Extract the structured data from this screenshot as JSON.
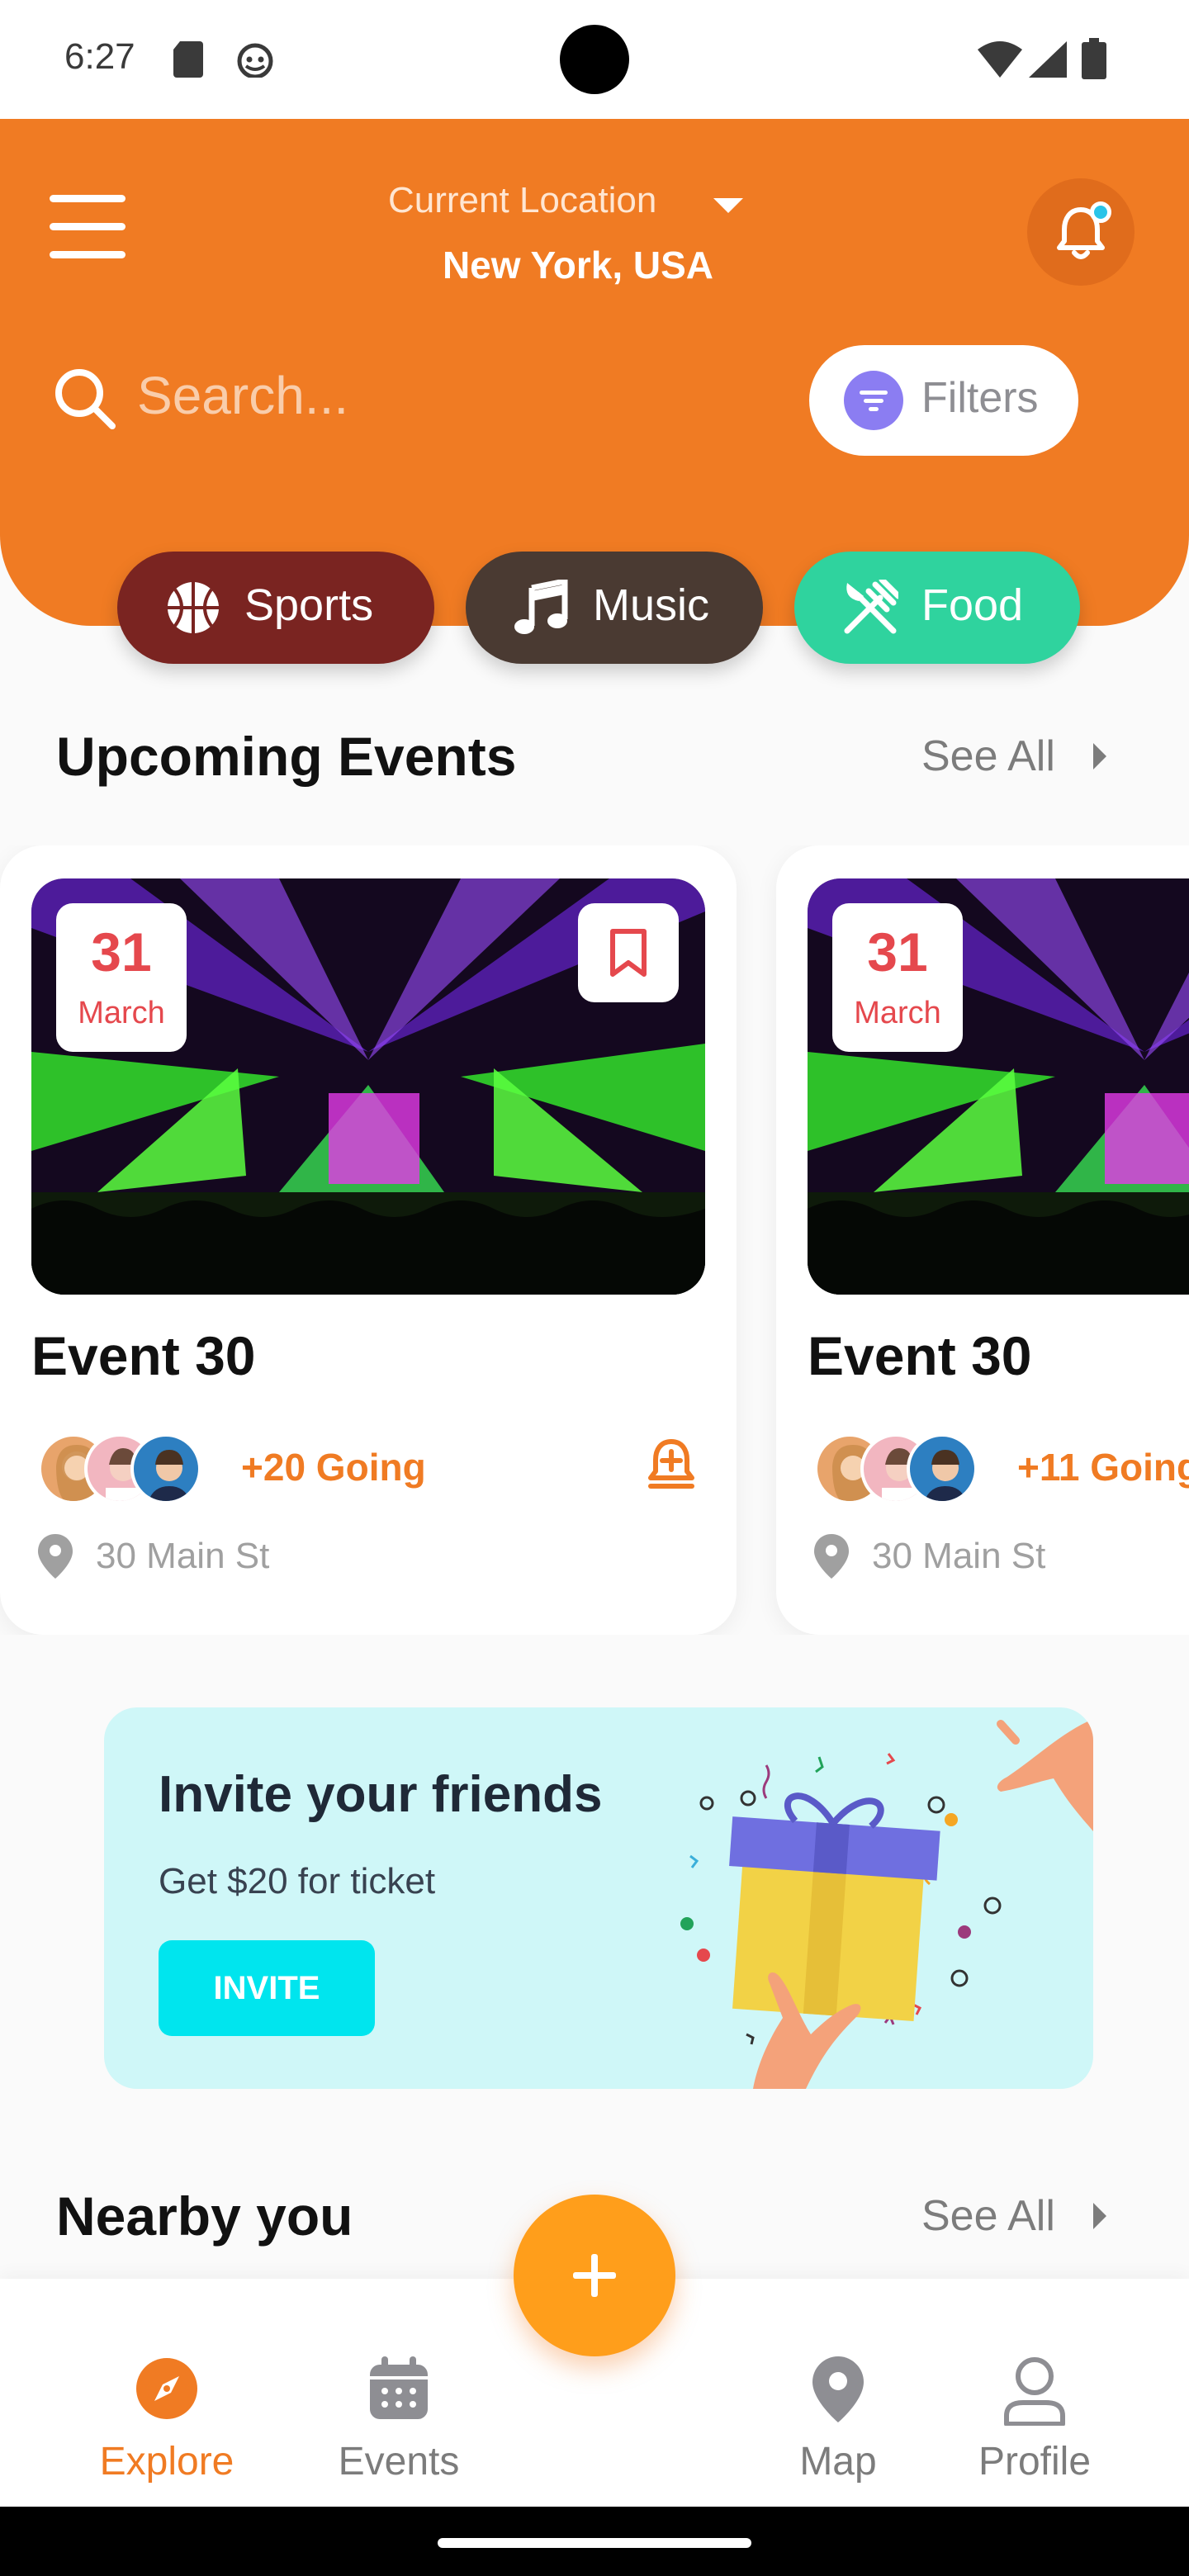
{
  "status_bar": {
    "time": "6:27"
  },
  "header": {
    "location_label": "Current Location",
    "location_value": "New York, USA",
    "search_placeholder": "Search...",
    "filters_label": "Filters"
  },
  "categories": [
    {
      "label": "Sports",
      "color": "#7A2421"
    },
    {
      "label": "Music",
      "color": "#4A3A32"
    },
    {
      "label": "Food",
      "color": "#2FD39E"
    }
  ],
  "upcoming": {
    "title": "Upcoming Events",
    "see_all": "See All",
    "events": [
      {
        "day": "31",
        "month": "March",
        "title": "Event 30",
        "going": "+20 Going",
        "address": "30 Main St"
      },
      {
        "day": "31",
        "month": "March",
        "title": "Event 30",
        "going": "+11 Going",
        "address": "30 Main St"
      }
    ]
  },
  "invite": {
    "title": "Invite your friends",
    "subtitle": "Get $20 for ticket",
    "button": "INVITE"
  },
  "nearby": {
    "title": "Nearby you",
    "see_all": "See All"
  },
  "nav": {
    "explore": "Explore",
    "events": "Events",
    "map": "Map",
    "profile": "Profile"
  },
  "colors": {
    "brand": "#F07B23",
    "fab": "#FF9E1B",
    "date": "#E5484D"
  }
}
